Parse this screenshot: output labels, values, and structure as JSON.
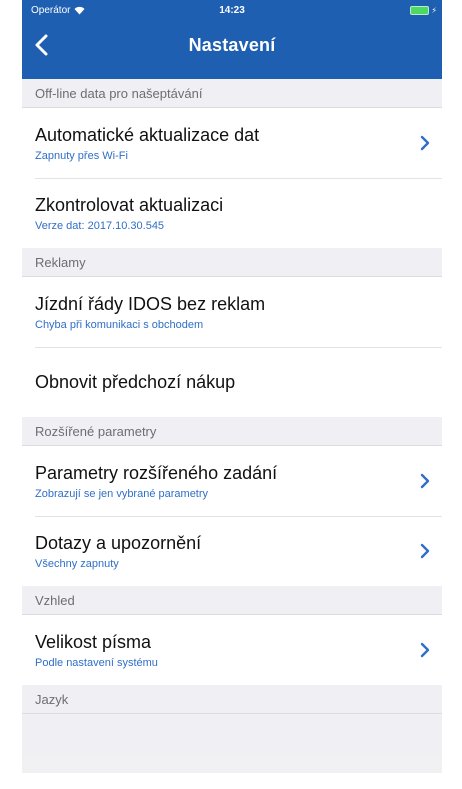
{
  "status_bar": {
    "carrier": "Operátor",
    "time": "14:23"
  },
  "nav": {
    "title": "Nastavení",
    "back_icon": "chevron-left-icon"
  },
  "sections": {
    "offline": {
      "header": "Off-line data pro našeptávání",
      "auto_update": {
        "title": "Automatické aktualizace dat",
        "subtitle": "Zapnuty přes Wi-Fi"
      },
      "check_update": {
        "title": "Zkontrolovat aktualizaci",
        "subtitle": "Verze dat: 2017.10.30.545"
      }
    },
    "ads": {
      "header": "Reklamy",
      "no_ads": {
        "title": "Jízdní řády IDOS bez reklam",
        "subtitle": "Chyba při komunikaci s obchodem"
      },
      "restore": {
        "title": "Obnovit předchozí nákup"
      }
    },
    "advanced": {
      "header": "Rozšířené parametry",
      "extended_params": {
        "title": "Parametry rozšířeného zadání",
        "subtitle": "Zobrazují se jen vybrané parametry"
      },
      "queries": {
        "title": "Dotazy a upozornění",
        "subtitle": "Všechny zapnuty"
      }
    },
    "appearance": {
      "header": "Vzhled",
      "font_size": {
        "title": "Velikost písma",
        "subtitle": "Podle nastavení systému"
      }
    },
    "language": {
      "header": "Jazyk"
    }
  },
  "colors": {
    "nav_background": "#1f5fb2",
    "accent_text": "#2f6fc7",
    "chevron": "#2f6fc7",
    "battery": "#4cd964"
  }
}
